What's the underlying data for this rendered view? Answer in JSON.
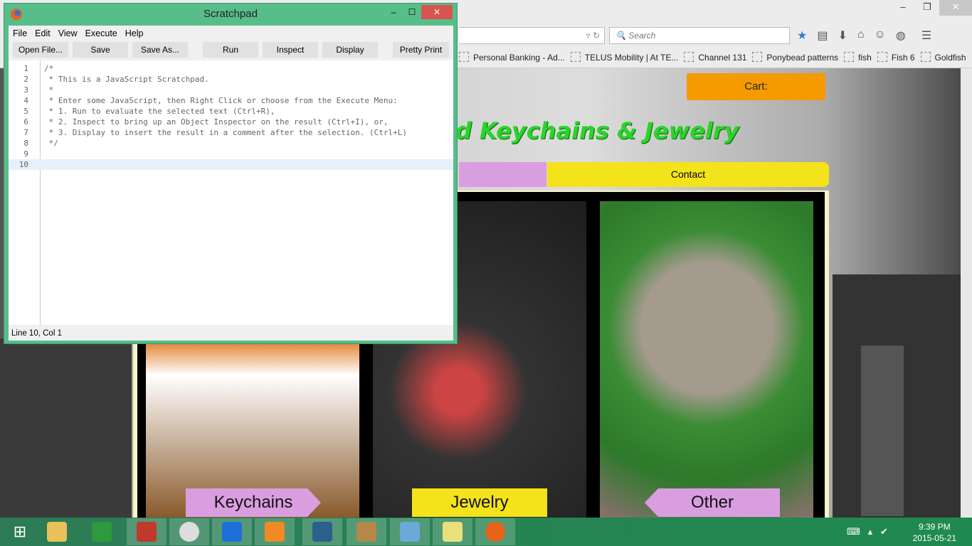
{
  "browser": {
    "search_placeholder": "Search",
    "bookmarks": [
      "Personal Banking - Ad...",
      "TELUS Mobility | At TE...",
      "Channel 131",
      "Ponybead patterns",
      "fish",
      "Fish 6",
      "Goldfish"
    ],
    "overflow": "»",
    "toolbar_icons": [
      "bookmark-star-icon",
      "reading-list-icon",
      "download-icon",
      "home-icon",
      "chat-icon",
      "globe-icon",
      "menu-icon"
    ]
  },
  "site": {
    "cart_label": "Cart:",
    "heading": "d Keychains & Jewelry",
    "nav_contact": "Contact",
    "categories": [
      {
        "label": "Keychains"
      },
      {
        "label": "Jewelry"
      },
      {
        "label": "Other"
      }
    ],
    "colors": {
      "cart": "#f59a00",
      "heading": "#2ad42a",
      "pink": "#d99ee0",
      "yellow": "#f4e31b"
    }
  },
  "scratchpad": {
    "title": "Scratchpad",
    "menu": [
      "File",
      "Edit",
      "View",
      "Execute",
      "Help"
    ],
    "buttons": [
      "Open File...",
      "Save",
      "Save As...",
      "Run",
      "Inspect",
      "Display",
      "Pretty Print"
    ],
    "lines": [
      "/*",
      " * This is a JavaScript Scratchpad.",
      " *",
      " * Enter some JavaScript, then Right Click or choose from the Execute Menu:",
      " * 1. Run to evaluate the selected text (Ctrl+R),",
      " * 2. Inspect to bring up an Object Inspector on the result (Ctrl+I), or,",
      " * 3. Display to insert the result in a comment after the selection. (Ctrl+L)",
      " */",
      "",
      ""
    ],
    "line_numbers": [
      "1",
      "2",
      "3",
      "4",
      "5",
      "6",
      "7",
      "8",
      "9",
      "10"
    ],
    "status": "Line 10, Col 1"
  },
  "taskbar": {
    "apps": [
      "windows-start",
      "file-explorer",
      "wps-writer",
      "winrar",
      "chrome",
      "malwarebytes",
      "media-player",
      "video-app",
      "library",
      "paint",
      "sticky-notes",
      "firefox"
    ],
    "time": "9:39 PM",
    "date": "2015-05-21"
  }
}
